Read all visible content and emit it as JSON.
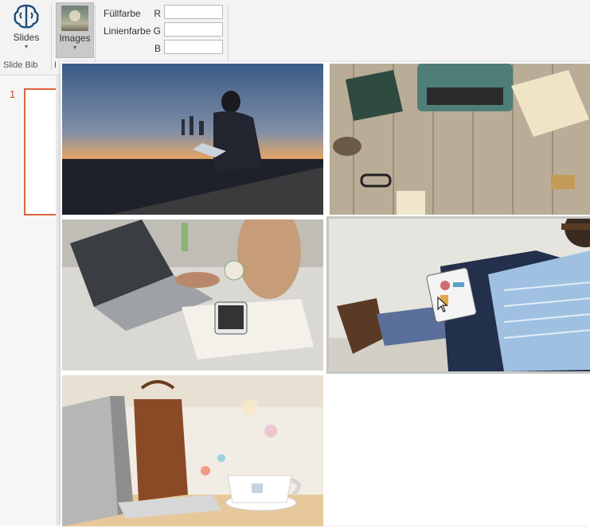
{
  "ribbon": {
    "slides_label": "Slides",
    "images_label": "Images",
    "dropdown_arrow": "▾",
    "group_slide_bib": "Slide Bib",
    "group_cut": "I",
    "fill_label": "Füllfarbe",
    "line_label": "Linienfarbe",
    "channels": [
      "R",
      "G",
      "B"
    ],
    "values": [
      "",
      "",
      ""
    ]
  },
  "slides": {
    "current_number": "1"
  },
  "gallery": {
    "images": [
      {
        "name": "man-laptop-sunset",
        "selected": false
      },
      {
        "name": "typewriter-desk",
        "selected": false
      },
      {
        "name": "laptop-phone-desk",
        "selected": false
      },
      {
        "name": "man-tablet-chart",
        "selected": true
      },
      {
        "name": "laptop-bag-coffee",
        "selected": false
      }
    ]
  },
  "colors": {
    "accent": "#d24726",
    "ribbon_bg": "#f3f3f3",
    "selection_border": "#c6c6c6"
  }
}
